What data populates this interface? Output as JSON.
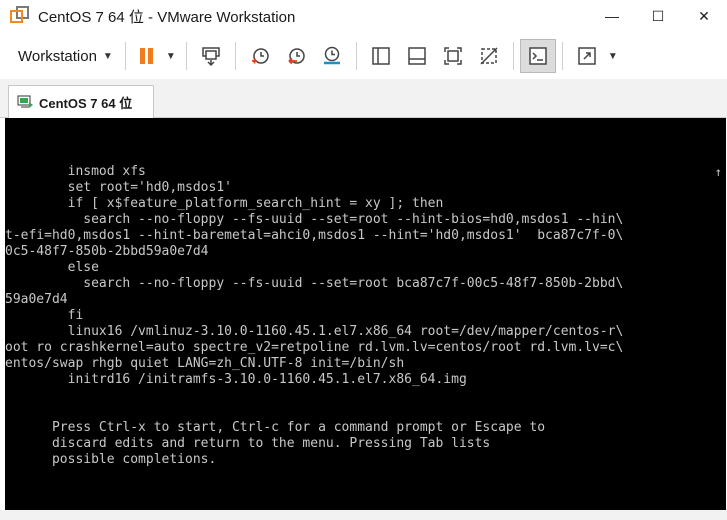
{
  "window": {
    "title": "CentOS 7 64 位 - VMware Workstation",
    "controls": {
      "minimize": "—",
      "maximize": "☐",
      "close": "✕"
    }
  },
  "toolbar": {
    "menu_label": "Workstation",
    "icons": [
      "pause-icon",
      "send-ctrl-alt-del-icon",
      "snapshot-take-icon",
      "snapshot-revert-icon",
      "snapshot-manager-icon",
      "show-library-icon",
      "thumbnail-bar-icon",
      "full-screen-icon",
      "unity-icon",
      "console-view-icon",
      "stretch-view-icon"
    ]
  },
  "tab": {
    "label": "CentOS 7 64 位"
  },
  "console": {
    "lines": [
      "        insmod xfs",
      "        set root='hd0,msdos1'",
      "        if [ x$feature_platform_search_hint = xy ]; then",
      "          search --no-floppy --fs-uuid --set=root --hint-bios=hd0,msdos1 --hin\\",
      "t-efi=hd0,msdos1 --hint-baremetal=ahci0,msdos1 --hint='hd0,msdos1'  bca87c7f-0\\",
      "0c5-48f7-850b-2bbd59a0e7d4",
      "        else",
      "          search --no-floppy --fs-uuid --set=root bca87c7f-00c5-48f7-850b-2bbd\\",
      "59a0e7d4",
      "        fi",
      "        linux16 /vmlinuz-3.10.0-1160.45.1.el7.x86_64 root=/dev/mapper/centos-r\\",
      "oot ro crashkernel=auto spectre_v2=retpoline rd.lvm.lv=centos/root rd.lvm.lv=c\\",
      "entos/swap rhgb quiet LANG=zh_CN.UTF-8 init=/bin/sh",
      "        initrd16 /initramfs-3.10.0-1160.45.1.el7.x86_64.img"
    ],
    "scroll_indicator": "↑",
    "help": [
      "      Press Ctrl-x to start, Ctrl-c for a command prompt or Escape to",
      "      discard edits and return to the menu. Pressing Tab lists",
      "      possible completions."
    ]
  },
  "colors": {
    "pause_accent": "#f07d1c",
    "console_bg": "#000000",
    "console_text": "#c8c8c8"
  }
}
